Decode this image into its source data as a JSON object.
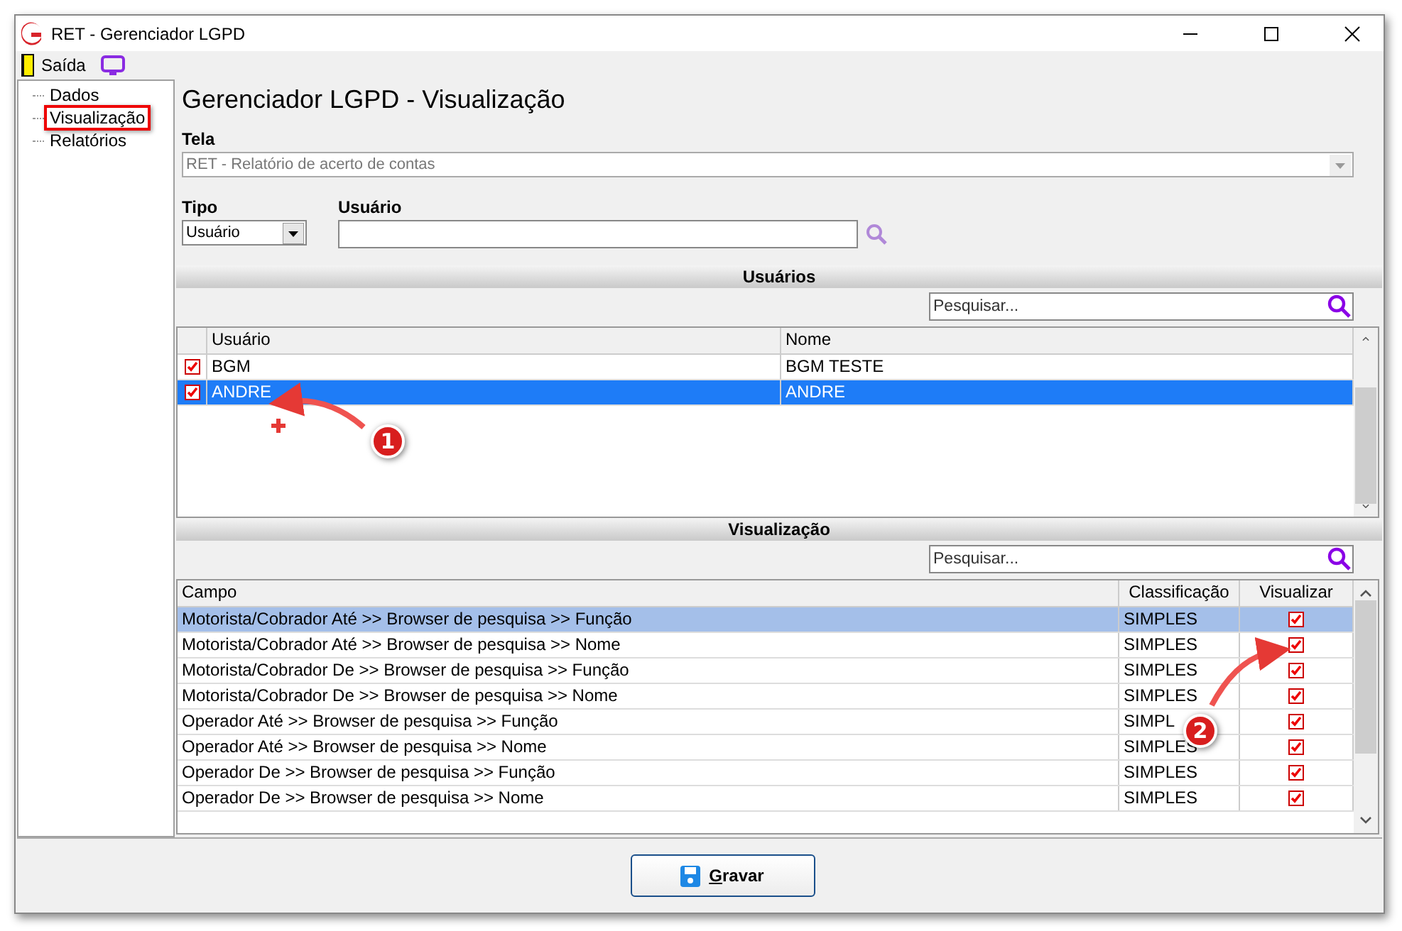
{
  "window": {
    "title": "RET - Gerenciador LGPD"
  },
  "toolbar": {
    "exit_label": "Saída"
  },
  "sidebar": {
    "items": [
      {
        "label": "Dados",
        "highlighted": false
      },
      {
        "label": "Visualização",
        "highlighted": true
      },
      {
        "label": "Relatórios",
        "highlighted": false
      }
    ]
  },
  "heading": "Gerenciador LGPD - Visualização",
  "tela": {
    "label": "Tela",
    "value": "RET - Relatório de acerto de contas",
    "disabled": true
  },
  "tipo": {
    "label": "Tipo",
    "value": "Usuário"
  },
  "usuario": {
    "label": "Usuário"
  },
  "users_section": {
    "title": "Usuários",
    "search_placeholder": "Pesquisar...",
    "columns": [
      "Usuário",
      "Nome"
    ],
    "rows": [
      {
        "checked": true,
        "selected": false,
        "user": "BGM",
        "name": "BGM TESTE"
      },
      {
        "checked": true,
        "selected": true,
        "user": "ANDRE",
        "name": "ANDRE"
      }
    ]
  },
  "view_section": {
    "title": "Visualização",
    "search_placeholder": "Pesquisar...",
    "columns": [
      "Campo",
      "Classificação",
      "Visualizar"
    ],
    "rows": [
      {
        "field": "Motorista/Cobrador Até >> Browser de pesquisa >> Função",
        "class": "SIMPLES",
        "checked": true,
        "selected": true
      },
      {
        "field": "Motorista/Cobrador Até >> Browser de pesquisa >> Nome",
        "class": "SIMPLES",
        "checked": true,
        "selected": false
      },
      {
        "field": "Motorista/Cobrador De >> Browser de pesquisa >> Função",
        "class": "SIMPLES",
        "checked": true,
        "selected": false
      },
      {
        "field": "Motorista/Cobrador De >> Browser de pesquisa >> Nome",
        "class": "SIMPLES",
        "checked": true,
        "selected": false
      },
      {
        "field": "Operador Até >> Browser de pesquisa >> Função",
        "class": "SIMPL",
        "checked": true,
        "selected": false
      },
      {
        "field": "Operador Até >> Browser de pesquisa >> Nome",
        "class": "SIMPLES",
        "checked": true,
        "selected": false
      },
      {
        "field": "Operador De >> Browser de pesquisa >> Função",
        "class": "SIMPLES",
        "checked": true,
        "selected": false
      },
      {
        "field": "Operador De >> Browser de pesquisa >> Nome",
        "class": "SIMPLES",
        "checked": true,
        "selected": false
      }
    ]
  },
  "save_button": {
    "label": "Gravar"
  },
  "callouts": [
    {
      "number": "1"
    },
    {
      "number": "2"
    }
  ]
}
